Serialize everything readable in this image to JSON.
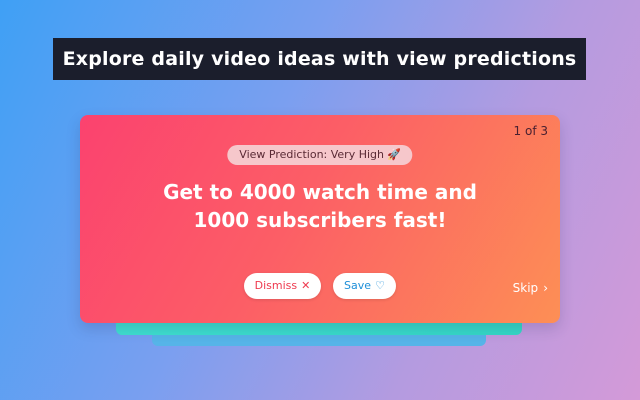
{
  "banner": {
    "title": "Explore daily video ideas with view predictions"
  },
  "card": {
    "counter": "1 of 3",
    "prediction_label": "View Prediction: Very High",
    "prediction_icon": "🚀",
    "headline_line1": "Get to 4000 watch time and",
    "headline_line2": "1000 subscribers fast!",
    "dismiss_label": "Dismiss",
    "dismiss_icon": "✕",
    "save_label": "Save",
    "save_icon": "♡",
    "skip_label": "Skip",
    "skip_icon": "›"
  },
  "colors": {
    "banner_bg": "#1b1e2c",
    "card_gradient_start": "#fb426f",
    "card_gradient_end": "#fd8f55",
    "dismiss_text": "#ee3a4f",
    "save_text": "#1e8fd8",
    "stack_mid": "#3fe0d0",
    "stack_back": "#56b4e8"
  }
}
